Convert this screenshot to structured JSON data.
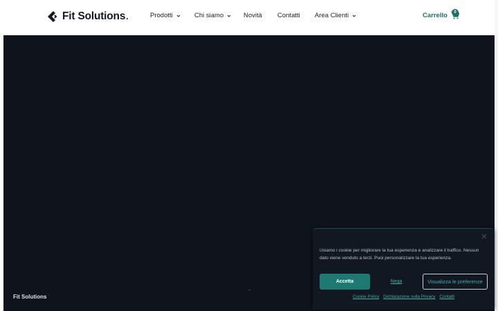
{
  "header": {
    "logo_text": "Fit Solutions",
    "logo_sub": "SOLUTIONS",
    "nav": [
      {
        "label": "Prodotti",
        "has_dropdown": true
      },
      {
        "label": "Chi siamo",
        "has_dropdown": true
      },
      {
        "label": "Novità",
        "has_dropdown": false
      },
      {
        "label": "Contatti",
        "has_dropdown": false
      },
      {
        "label": "Area Clienti",
        "has_dropdown": true
      }
    ],
    "cart_label": "Carrello",
    "cart_count": "0"
  },
  "footer": {
    "brand": "Fit Solutions"
  },
  "cookie": {
    "text": "Usiamo i cookie per migliorare la tua esperienza e analizzare il traffico. Nessun dato viene venduto a terzi. Puoi personalizzare la tua esperienza.",
    "accept": "Accetta",
    "deny": "Nega",
    "prefs": "Visualizza le preferenze",
    "links": [
      "Cookie Policy",
      "Dichiarazione sulla Privacy",
      "Contatti"
    ]
  },
  "colors": {
    "accent": "#1d6f68",
    "hero_bg": "#0f141c",
    "cookie_bg": "#111821"
  }
}
